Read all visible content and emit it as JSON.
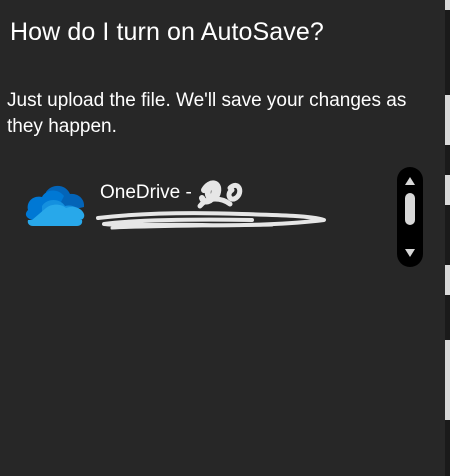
{
  "dialog": {
    "title": "How do I turn on AutoSave?",
    "description": "Just upload the file. We'll save your changes as they happen."
  },
  "locations": [
    {
      "name": "OneDrive -",
      "icon": "onedrive-cloud-icon"
    }
  ],
  "scrollbar": {
    "up_icon": "triangle-up-icon",
    "down_icon": "triangle-down-icon"
  },
  "colors": {
    "background": "#272727",
    "text": "#ffffff",
    "onedrive_blue_dark": "#0364b8",
    "onedrive_blue": "#0078d4",
    "onedrive_blue_light": "#1490df",
    "onedrive_blue_lightest": "#28a8ea",
    "scrollbar_track": "#000000",
    "scrollbar_thumb": "#d8d8d8"
  }
}
